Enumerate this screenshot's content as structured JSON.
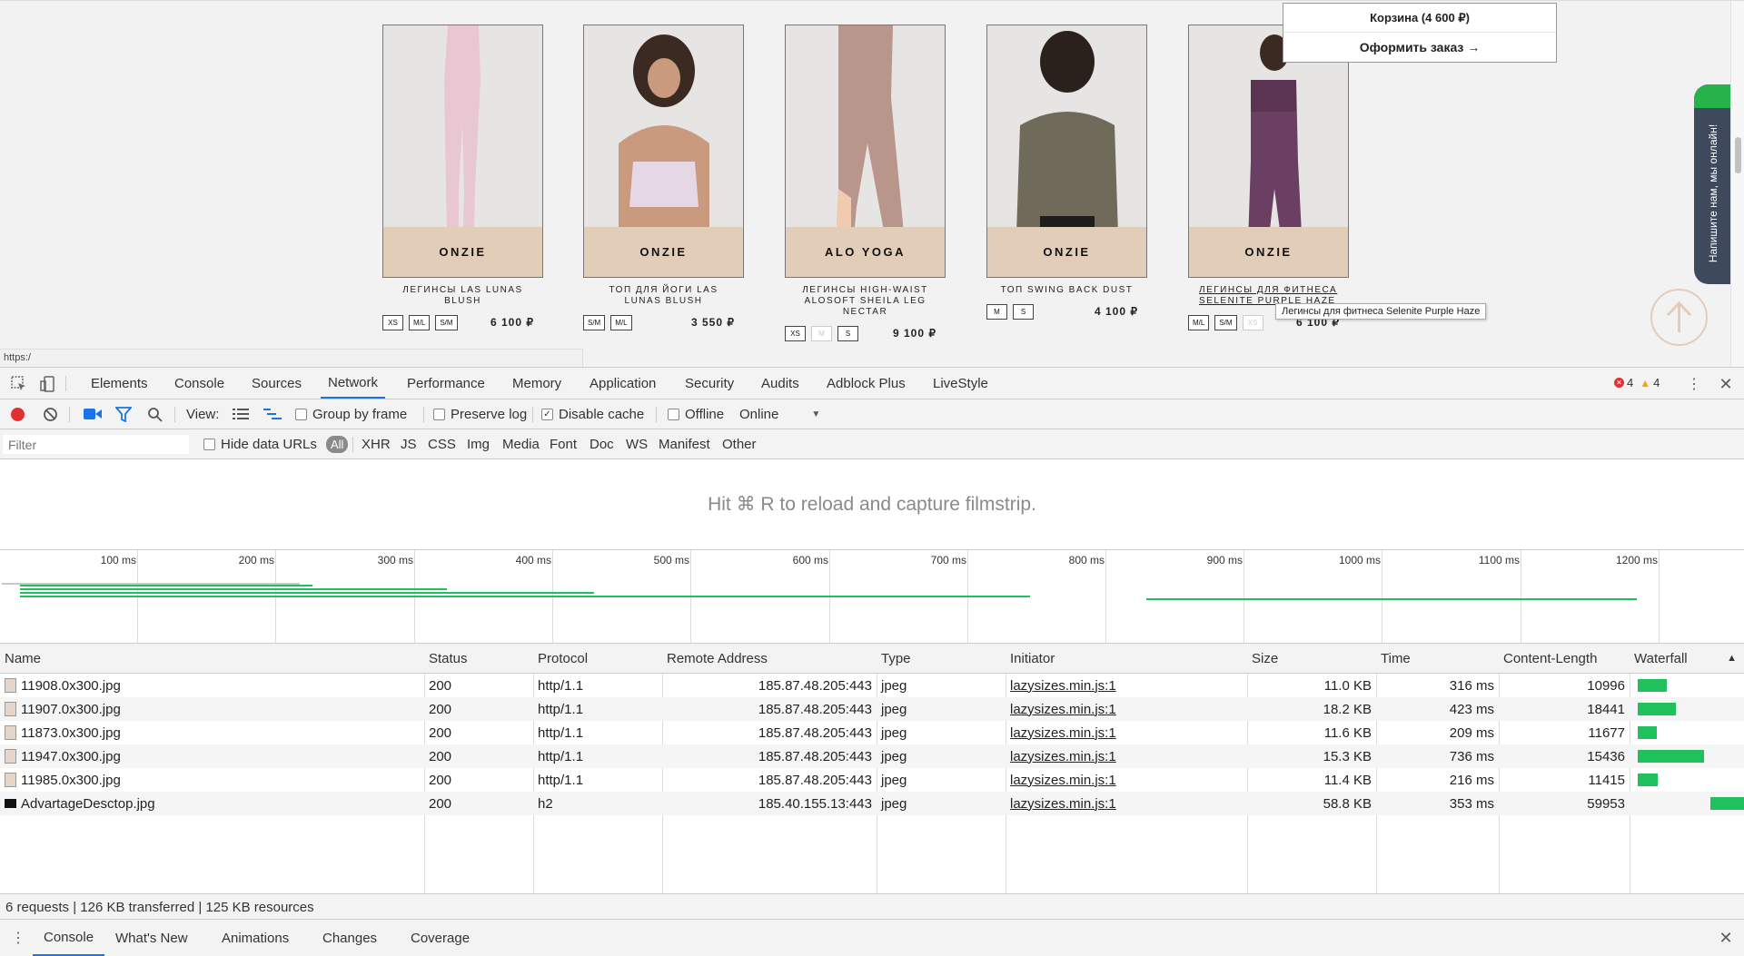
{
  "site": {
    "products": [
      {
        "brand": "ONZIE",
        "name": "ЛЕГИНСЫ LAS LUNAS BLUSH",
        "sizes": [
          "XS",
          "M/L",
          "S/M"
        ],
        "price": "6 100 ₽"
      },
      {
        "brand": "ONZIE",
        "name": "ТОП ДЛЯ ЙОГИ LAS LUNAS BLUSH",
        "sizes": [
          "S/M",
          "M/L"
        ],
        "price": "3 550 ₽"
      },
      {
        "brand": "ALO YOGA",
        "name": "ЛЕГИНСЫ HIGH-WAIST ALOSOFT SHEILA LEG NECTAR",
        "sizes": [
          "XS",
          "M",
          "S"
        ],
        "price": "9 100 ₽"
      },
      {
        "brand": "ONZIE",
        "name": "ТОП SWING BACK DUST",
        "sizes": [
          "M",
          "S"
        ],
        "price": "4 100 ₽"
      },
      {
        "brand": "ONZIE",
        "name": "ЛЕГИНСЫ ДЛЯ ФИТНЕСА SELENITE PURPLE HAZE",
        "sizes": [
          "M/L",
          "S/M",
          "XS"
        ],
        "price": "6 100 ₽"
      }
    ],
    "cart": {
      "title": "Корзина (4 600 ₽)",
      "checkout": "Оформить заказ →"
    },
    "chat_label": "Напишите нам, мы онлайн!",
    "tooltip": "Легинсы для фитнеса Selenite Purple Haze",
    "status_url": "https:/"
  },
  "devtools": {
    "tabs": [
      "Elements",
      "Console",
      "Sources",
      "Network",
      "Performance",
      "Memory",
      "Application",
      "Security",
      "Audits",
      "Adblock Plus",
      "LiveStyle"
    ],
    "active_tab": "Network",
    "errors": "4",
    "warnings": "4",
    "toolbar": {
      "view_label": "View:",
      "group_by_frame": "Group by frame",
      "preserve_log": "Preserve log",
      "disable_cache": "Disable cache",
      "offline": "Offline",
      "throttle": "Online"
    },
    "filter": {
      "placeholder": "Filter",
      "hide_data_urls": "Hide data URLs",
      "types": [
        "All",
        "XHR",
        "JS",
        "CSS",
        "Img",
        "Media",
        "Font",
        "Doc",
        "WS",
        "Manifest",
        "Other"
      ]
    },
    "filmstrip_hint": "Hit ⌘ R to reload and capture filmstrip.",
    "overview_ticks": [
      "100 ms",
      "200 ms",
      "300 ms",
      "400 ms",
      "500 ms",
      "600 ms",
      "700 ms",
      "800 ms",
      "900 ms",
      "1000 ms",
      "1100 ms",
      "1200 ms"
    ],
    "columns": [
      "Name",
      "Status",
      "Protocol",
      "Remote Address",
      "Type",
      "Initiator",
      "Size",
      "Time",
      "Content-Length",
      "Waterfall"
    ],
    "rows": [
      {
        "name": "11908.0x300.jpg",
        "status": "200",
        "protocol": "http/1.1",
        "remote": "185.87.48.205:443",
        "type": "jpeg",
        "initiator": "lazysizes.min.js:1",
        "size": "11.0 KB",
        "time": "316 ms",
        "length": "10996"
      },
      {
        "name": "11907.0x300.jpg",
        "status": "200",
        "protocol": "http/1.1",
        "remote": "185.87.48.205:443",
        "type": "jpeg",
        "initiator": "lazysizes.min.js:1",
        "size": "18.2 KB",
        "time": "423 ms",
        "length": "18441"
      },
      {
        "name": "11873.0x300.jpg",
        "status": "200",
        "protocol": "http/1.1",
        "remote": "185.87.48.205:443",
        "type": "jpeg",
        "initiator": "lazysizes.min.js:1",
        "size": "11.6 KB",
        "time": "209 ms",
        "length": "11677"
      },
      {
        "name": "11947.0x300.jpg",
        "status": "200",
        "protocol": "http/1.1",
        "remote": "185.87.48.205:443",
        "type": "jpeg",
        "initiator": "lazysizes.min.js:1",
        "size": "15.3 KB",
        "time": "736 ms",
        "length": "15436"
      },
      {
        "name": "11985.0x300.jpg",
        "status": "200",
        "protocol": "http/1.1",
        "remote": "185.87.48.205:443",
        "type": "jpeg",
        "initiator": "lazysizes.min.js:1",
        "size": "11.4 KB",
        "time": "216 ms",
        "length": "11415"
      },
      {
        "name": "AdvartageDesctop.jpg",
        "status": "200",
        "protocol": "h2",
        "remote": "185.40.155.13:443",
        "type": "jpeg",
        "initiator": "lazysizes.min.js:1",
        "size": "58.8 KB",
        "time": "353 ms",
        "length": "59953"
      }
    ],
    "summary": "6 requests | 126 KB transferred | 125 KB resources",
    "drawer_tabs": [
      "Console",
      "What's New",
      "Animations",
      "Changes",
      "Coverage"
    ]
  },
  "colors": {
    "accent": "#1a73e8",
    "waterfall": "#20c05c",
    "brand_band": "#e2cdb9"
  }
}
